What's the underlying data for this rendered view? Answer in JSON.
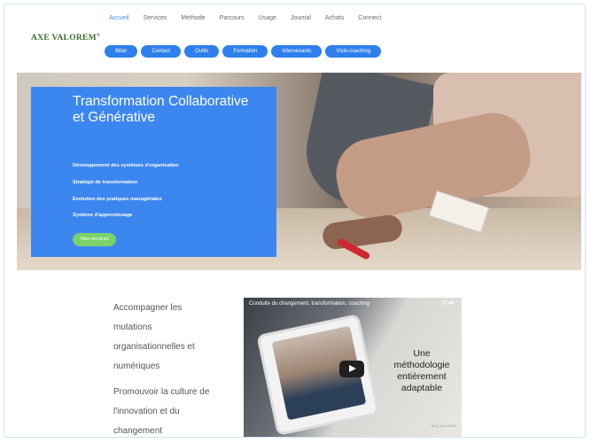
{
  "nav": {
    "items": [
      "Accueil",
      "Services",
      "Méthode",
      "Parcours",
      "Usage",
      "Journal",
      "Achats",
      "Connect"
    ]
  },
  "logo": {
    "text": "AXE VALOREM",
    "mark": "®"
  },
  "pills": [
    "Bilan",
    "Contact",
    "Outils",
    "Formation",
    "Intervenants",
    "Visio-coaching"
  ],
  "hero": {
    "title": "Transformation Collaborative et Générative",
    "bullets": [
      "Développement des systèmes d'organisation",
      "Stratégie de transformation",
      "Evolution des pratiques managériales",
      "Système d'apprentissage"
    ],
    "button": "Nos services",
    "card_text": "Une"
  },
  "body": {
    "para1": [
      "Accompagner les",
      "mutations",
      "organisationnelles et",
      "numériques"
    ],
    "para2": [
      "Promouvoir la culture de",
      "l'innovation et du",
      "changement"
    ]
  },
  "video": {
    "title": "Conduite du changement, transformation, coaching",
    "overlay": [
      "Une",
      "méthodologie",
      "entièrement",
      "adaptable"
    ],
    "brand": "AXE VALOREM"
  }
}
